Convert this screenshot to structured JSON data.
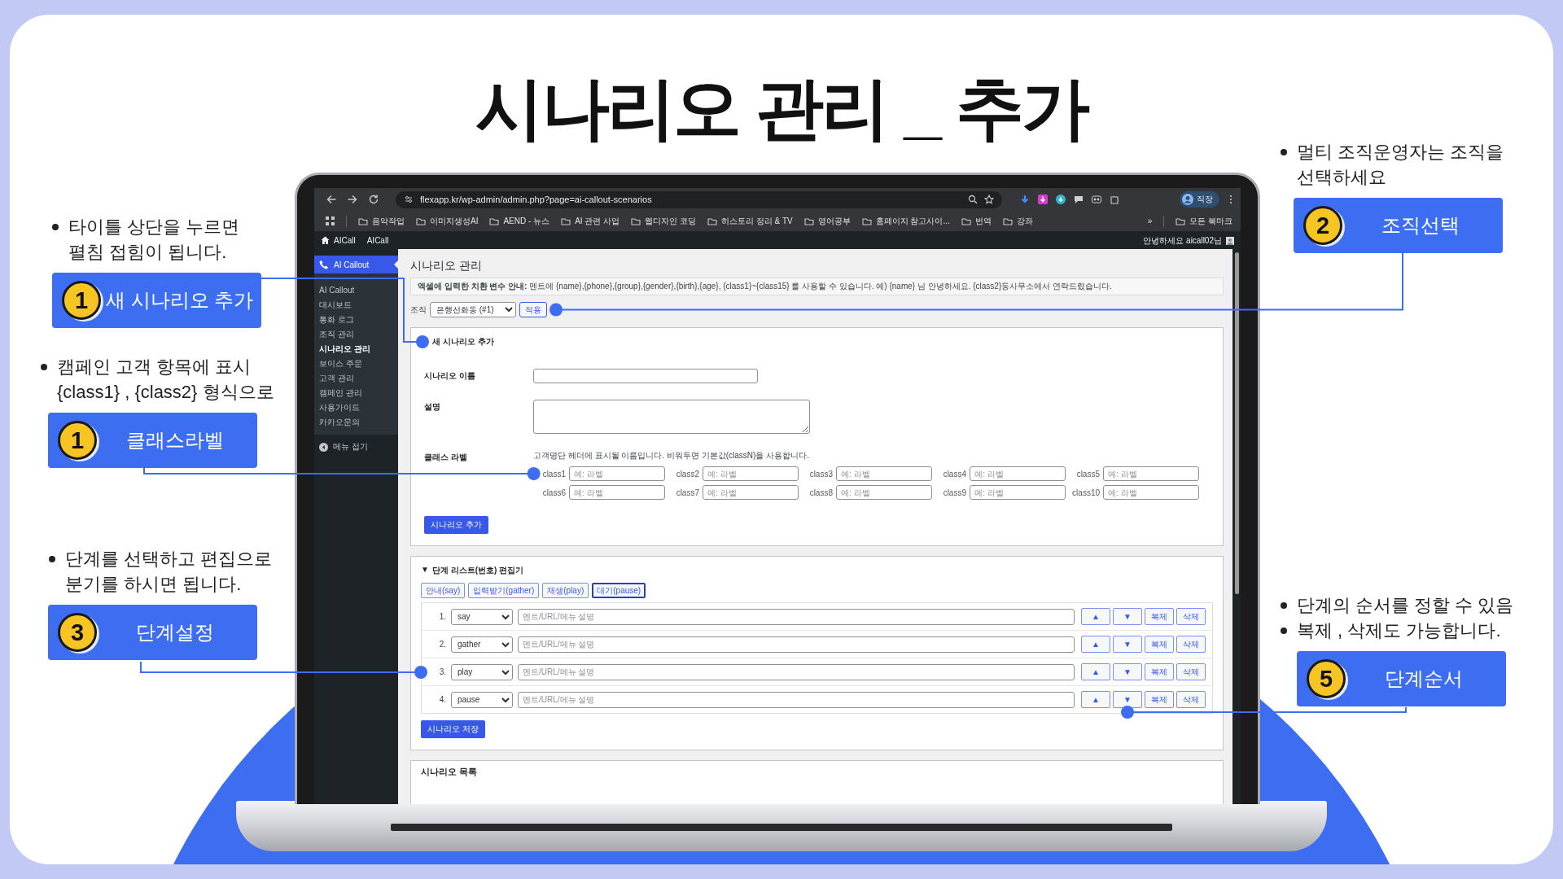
{
  "slide": {
    "title": "시나리오 관리 _ 추가"
  },
  "callouts": [
    {
      "bullets": [
        "타이틀 상단을 누르면\n펼침 접힘이 됩니다."
      ],
      "number": "1",
      "label": "새 시나리오 추가"
    },
    {
      "bullets": [
        "멀티 조직운영자는 조직을\n선택하세요"
      ],
      "number": "2",
      "label": "조직선택"
    },
    {
      "bullets": [
        "캠페인 고객 항목에 표시\n{class1} , {class2} 형식으로"
      ],
      "number": "1",
      "label": "클래스라벨"
    },
    {
      "bullets": [
        "단계를 선택하고 편집으로\n분기를 하시면 됩니다."
      ],
      "number": "3",
      "label": "단계설정"
    },
    {
      "bullets": [
        "단계의 순서를 정할 수 있음",
        "복제 , 삭제도 가능합니다."
      ],
      "number": "5",
      "label": "단계순서"
    }
  ],
  "browser": {
    "url": "flexapp.kr/wp-admin/admin.php?page=ai-callout-scenarios",
    "profile": "직장",
    "bookmarks": [
      "음악작업",
      "이미지생성AI",
      "AEND - 뉴스",
      "AI 관련 사업",
      "웹디자인 코딩",
      "히스토리 정리 & TV",
      "영어공부",
      "홈페이지 참고사이...",
      "번역",
      "강좌"
    ],
    "more": "»",
    "all_bookmarks": "모든 북마크"
  },
  "admin_bar": {
    "site": "AICall",
    "site_2": "AICall",
    "greeting": "안녕하세요 aicall02님"
  },
  "sidebar": {
    "menu": "AI Callout",
    "items": [
      {
        "label": "AI Callout",
        "selected": false
      },
      {
        "label": "대시보드",
        "selected": false
      },
      {
        "label": "통화 로그",
        "selected": false
      },
      {
        "label": "조직 관리",
        "selected": false
      },
      {
        "label": "시나리오 관리",
        "selected": true
      },
      {
        "label": "보이스 주문",
        "selected": false
      },
      {
        "label": "고객 관리",
        "selected": false
      },
      {
        "label": "캠페인 관리",
        "selected": false
      },
      {
        "label": "사용가이드",
        "selected": false
      },
      {
        "label": "카카오문의",
        "selected": false
      }
    ],
    "collapse": "메뉴 접기"
  },
  "page": {
    "title": "시나리오 관리",
    "notice": "**엑셀에 입력한 치환 변수 안내:** 멘트에 {name},{phone},{group},{gender},{birth},{age}, {class1}~{class15} 를 사용할 수 있습니다. 예) {name} 님 안녕하세요. {class2}동사무소에서 연락드렸습니다.",
    "org": {
      "label": "조직",
      "value": "은행선화동 (#1)",
      "apply": "적용"
    },
    "new_scenario": {
      "title": "새 시나리오 추가",
      "name_label": "시나리오 이름",
      "desc_label": "설명",
      "class_label": "클래스 라벨",
      "class_help": "고객명단 헤더에 표시될 이름입니다. 비워두면 기본값(classN)을 사용합니다.",
      "classes": [
        {
          "label": "class1",
          "placeholder": "예: 라벨"
        },
        {
          "label": "class2",
          "placeholder": "예: 라벨"
        },
        {
          "label": "class3",
          "placeholder": "예: 라벨"
        },
        {
          "label": "class4",
          "placeholder": "예: 라벨"
        },
        {
          "label": "class5",
          "placeholder": "예: 라벨"
        },
        {
          "label": "class6",
          "placeholder": "예: 라벨"
        },
        {
          "label": "class7",
          "placeholder": "예: 라벨"
        },
        {
          "label": "class8",
          "placeholder": "예: 라벨"
        },
        {
          "label": "class9",
          "placeholder": "예: 라벨"
        },
        {
          "label": "class10",
          "placeholder": "예: 라벨"
        }
      ],
      "submit": "시나리오 추가"
    },
    "step_editor": {
      "toggle": "▼",
      "title": "단계 리스트(번호) 편집기",
      "add_buttons": [
        {
          "label": "안내(say)",
          "focused": false
        },
        {
          "label": "입력받기(gather)",
          "focused": false
        },
        {
          "label": "재생(play)",
          "focused": false
        },
        {
          "label": "대기(pause)",
          "focused": true
        }
      ],
      "steps": [
        {
          "number": "1.",
          "type": "say",
          "placeholder": "멘트/URL/메뉴 설명",
          "up": "▲",
          "down": "▼",
          "copy": "복제",
          "delete": "삭제"
        },
        {
          "number": "2.",
          "type": "gather",
          "placeholder": "멘트/URL/메뉴 설명",
          "up": "▲",
          "down": "▼",
          "copy": "복제",
          "delete": "삭제"
        },
        {
          "number": "3.",
          "type": "play",
          "placeholder": "멘트/URL/메뉴 설명",
          "up": "▲",
          "down": "▼",
          "copy": "복제",
          "delete": "삭제"
        },
        {
          "number": "4.",
          "type": "pause",
          "placeholder": "멘트/URL/메뉴 설명",
          "up": "▲",
          "down": "▼",
          "copy": "복제",
          "delete": "삭제"
        }
      ],
      "save": "시나리오 저장"
    },
    "list": {
      "title": "시나리오 목록"
    }
  }
}
